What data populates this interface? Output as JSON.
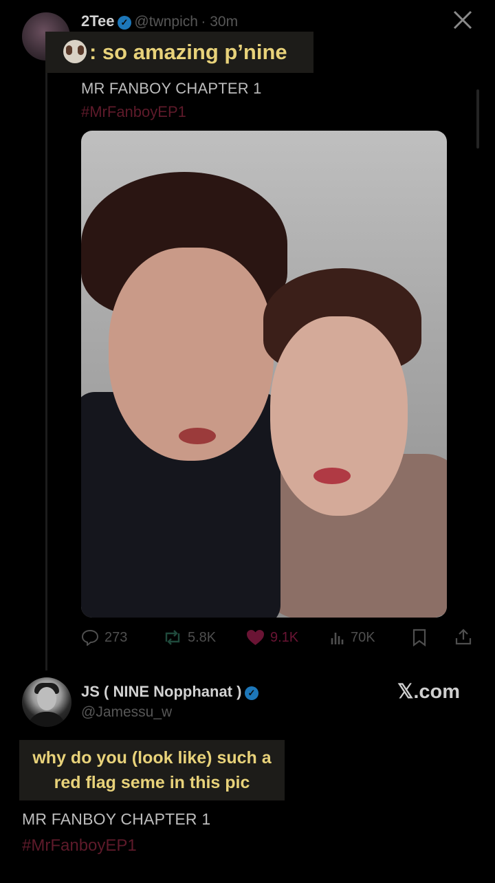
{
  "tweet": {
    "display_name": "2Tee",
    "handle": "@twnpich",
    "time": "· 30m",
    "caption": ": so amazing p’nine",
    "text": "MR FANBOY CHAPTER 1",
    "hashtag": "#MrFanboyEP1",
    "metrics": {
      "replies": "273",
      "reposts": "5.8K",
      "likes": "9.1K",
      "views": "70K"
    }
  },
  "reply": {
    "display_name": "JS ( NINE Nopphanat )",
    "handle": "@Jamessu_w",
    "caption_line1": "why do you (look like) such a",
    "caption_line2": "red flag seme in this pic",
    "text": "MR FANBOY CHAPTER 1",
    "hashtag": "#MrFanboyEP1"
  },
  "watermark": "𝕏.com",
  "colors": {
    "background": "#000000",
    "caption_bg": "#1d1c19",
    "caption_text": "#e8d27a",
    "verified": "#1d77b9",
    "like": "#6a1434"
  },
  "icons": [
    "close-icon",
    "verified-icon",
    "reply-icon",
    "repost-icon",
    "heart-icon",
    "views-icon",
    "bookmark-icon",
    "share-icon",
    "dog-emoji-icon"
  ]
}
